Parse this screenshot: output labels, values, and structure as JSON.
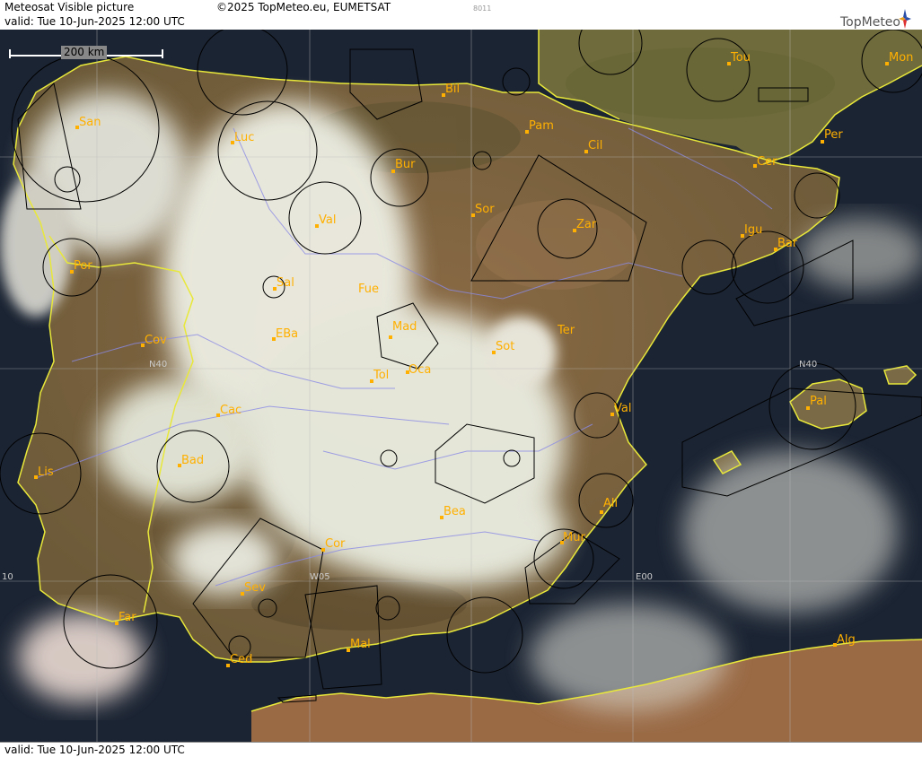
{
  "header": {
    "title": "Meteosat Visible picture",
    "valid": "valid:  Tue  10-Jun-2025  12:00 UTC",
    "copyright": "©2025 TopMeteo.eu, EUMETSAT",
    "image_code": "8011",
    "brand": "TopMeteo"
  },
  "footer": {
    "valid": "valid:  Tue  10-Jun-2025  12:00 UTC"
  },
  "scale": {
    "label": "200 km"
  },
  "grid_labels": {
    "n40_west": "N40",
    "n40_east": "N40",
    "w05": "W05",
    "e00": "E00",
    "w10": "10"
  },
  "cities": [
    {
      "key": "san",
      "label": "San"
    },
    {
      "key": "luc",
      "label": "Luc"
    },
    {
      "key": "bil",
      "label": "Bil"
    },
    {
      "key": "pam",
      "label": "Pam"
    },
    {
      "key": "tou",
      "label": "Tou"
    },
    {
      "key": "mon",
      "label": "Mon"
    },
    {
      "key": "per",
      "label": "Per"
    },
    {
      "key": "cil",
      "label": "Cil"
    },
    {
      "key": "cer",
      "label": "Cer"
    },
    {
      "key": "bur",
      "label": "Bur"
    },
    {
      "key": "val1",
      "label": "Val"
    },
    {
      "key": "sor",
      "label": "Sor"
    },
    {
      "key": "zar",
      "label": "Zar"
    },
    {
      "key": "igu",
      "label": "Igu"
    },
    {
      "key": "bar",
      "label": "Bar"
    },
    {
      "key": "por",
      "label": "Por"
    },
    {
      "key": "sal",
      "label": "Sal"
    },
    {
      "key": "fue",
      "label": "Fue"
    },
    {
      "key": "mad",
      "label": "Mad"
    },
    {
      "key": "cov",
      "label": "Cov"
    },
    {
      "key": "eba",
      "label": "EBa"
    },
    {
      "key": "sot",
      "label": "Sot"
    },
    {
      "key": "ter",
      "label": "Ter"
    },
    {
      "key": "tol",
      "label": "Tol"
    },
    {
      "key": "oca",
      "label": "Oca"
    },
    {
      "key": "cac",
      "label": "Cac"
    },
    {
      "key": "val2",
      "label": "Val"
    },
    {
      "key": "pal",
      "label": "Pal"
    },
    {
      "key": "lis",
      "label": "Lis"
    },
    {
      "key": "bad",
      "label": "Bad"
    },
    {
      "key": "ali",
      "label": "Ali"
    },
    {
      "key": "bea",
      "label": "Bea"
    },
    {
      "key": "mur",
      "label": "Mur"
    },
    {
      "key": "cor",
      "label": "Cor"
    },
    {
      "key": "sev",
      "label": "Sev"
    },
    {
      "key": "far",
      "label": "Far"
    },
    {
      "key": "mal",
      "label": "Mal"
    },
    {
      "key": "ced",
      "label": "Ced"
    },
    {
      "key": "alg",
      "label": "Alg"
    }
  ]
}
